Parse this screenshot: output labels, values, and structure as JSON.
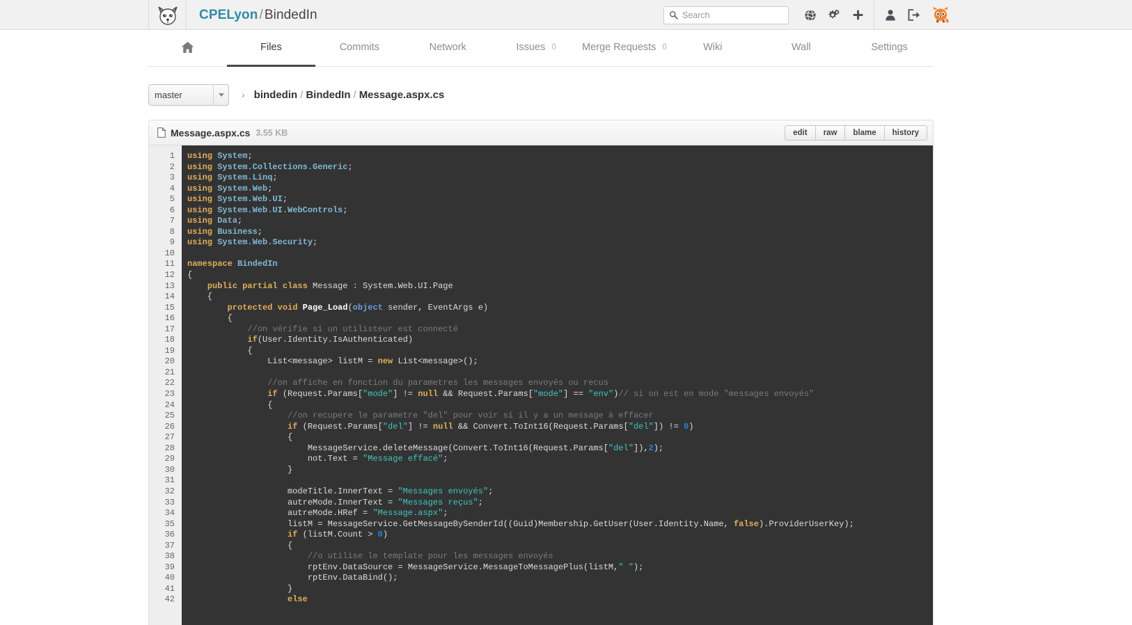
{
  "header": {
    "logo_icon": "gitlab-fox-logo",
    "namespace": "CPELyon",
    "separator": "/",
    "project": "BindedIn",
    "search_placeholder": "Search",
    "search_value": "",
    "icons": [
      {
        "name": "public-explore-icon",
        "glyph": "globe"
      },
      {
        "name": "admin-settings-icon",
        "glyph": "gears"
      },
      {
        "name": "new-project-icon",
        "glyph": "plus"
      },
      {
        "name": "profile-icon",
        "glyph": "user"
      },
      {
        "name": "sign-out-icon",
        "glyph": "logout"
      }
    ],
    "avatar_name": "user-avatar-fox"
  },
  "nav": {
    "items": [
      {
        "label": "",
        "name": "home",
        "icon": "home-icon",
        "active": false
      },
      {
        "label": "Files",
        "name": "files",
        "active": true
      },
      {
        "label": "Commits",
        "name": "commits",
        "active": false
      },
      {
        "label": "Network",
        "name": "network",
        "active": false
      },
      {
        "label": "Issues",
        "name": "issues",
        "count": "0",
        "active": false
      },
      {
        "label": "Merge Requests",
        "name": "merge-requests",
        "count": "0",
        "active": false
      },
      {
        "label": "Wiki",
        "name": "wiki",
        "active": false
      },
      {
        "label": "Wall",
        "name": "wall",
        "active": false
      },
      {
        "label": "Settings",
        "name": "settings",
        "active": false
      }
    ]
  },
  "branch": {
    "selected": "master",
    "chevron": "›"
  },
  "breadcrumb": {
    "parts": [
      "bindedin",
      "BindedIn",
      "Message.aspx.cs"
    ]
  },
  "file": {
    "icon": "file-icon",
    "name": "Message.aspx.cs",
    "size": "3.55 KB",
    "actions": [
      {
        "label": "edit",
        "name": "edit-button"
      },
      {
        "label": "raw",
        "name": "raw-button"
      },
      {
        "label": "blame",
        "name": "blame-button"
      },
      {
        "label": "history",
        "name": "history-button"
      }
    ]
  },
  "code": {
    "first_line": 1,
    "last_visible_line": 42,
    "language": "csharp",
    "lines": [
      [
        [
          "k",
          "using "
        ],
        [
          "ns",
          "System"
        ],
        [
          "pn",
          ";"
        ]
      ],
      [
        [
          "k",
          "using "
        ],
        [
          "ns",
          "System.Collections.Generic"
        ],
        [
          "pn",
          ";"
        ]
      ],
      [
        [
          "k",
          "using "
        ],
        [
          "ns",
          "System.Linq"
        ],
        [
          "pn",
          ";"
        ]
      ],
      [
        [
          "k",
          "using "
        ],
        [
          "ns",
          "System.Web"
        ],
        [
          "pn",
          ";"
        ]
      ],
      [
        [
          "k",
          "using "
        ],
        [
          "ns",
          "System.Web.UI"
        ],
        [
          "pn",
          ";"
        ]
      ],
      [
        [
          "k",
          "using "
        ],
        [
          "ns",
          "System.Web.UI.WebControls"
        ],
        [
          "pn",
          ";"
        ]
      ],
      [
        [
          "k",
          "using "
        ],
        [
          "ns",
          "Data"
        ],
        [
          "pn",
          ";"
        ]
      ],
      [
        [
          "k",
          "using "
        ],
        [
          "ns",
          "Business"
        ],
        [
          "pn",
          ";"
        ]
      ],
      [
        [
          "k",
          "using "
        ],
        [
          "ns",
          "System.Web.Security"
        ],
        [
          "pn",
          ";"
        ]
      ],
      [],
      [
        [
          "k",
          "namespace "
        ],
        [
          "ns",
          "BindedIn"
        ]
      ],
      [
        [
          "pn",
          "{"
        ]
      ],
      [
        [
          "pn",
          "    "
        ],
        [
          "k",
          "public partial class "
        ],
        [
          "pn",
          "Message : System.Web.UI.Page"
        ]
      ],
      [
        [
          "pn",
          "    {"
        ]
      ],
      [
        [
          "pn",
          "        "
        ],
        [
          "k",
          "protected void "
        ],
        [
          "fn",
          "Page_Load"
        ],
        [
          "pn",
          "("
        ],
        [
          "bl",
          "object"
        ],
        [
          "pn",
          " sender, EventArgs e)"
        ]
      ],
      [
        [
          "pn",
          "        {"
        ]
      ],
      [
        [
          "pn",
          "            "
        ],
        [
          "cm",
          "//on vérifie si un utilisteur est connecté"
        ]
      ],
      [
        [
          "pn",
          "            "
        ],
        [
          "k",
          "if"
        ],
        [
          "pn",
          "(User.Identity.IsAuthenticated)"
        ]
      ],
      [
        [
          "pn",
          "            {"
        ]
      ],
      [
        [
          "pn",
          "                List<message> listM = "
        ],
        [
          "k",
          "new"
        ],
        [
          "pn",
          " List<message>();"
        ]
      ],
      [],
      [
        [
          "pn",
          "                "
        ],
        [
          "cm",
          "//on affiche en fonction du parametres les messages envoyés ou recus"
        ]
      ],
      [
        [
          "pn",
          "                "
        ],
        [
          "k",
          "if"
        ],
        [
          "pn",
          " (Request.Params["
        ],
        [
          "st",
          "\"mode\""
        ],
        [
          "pn",
          "] != "
        ],
        [
          "k",
          "null"
        ],
        [
          "pn",
          " && Request.Params["
        ],
        [
          "st",
          "\"mode\""
        ],
        [
          "pn",
          "] == "
        ],
        [
          "st",
          "\"env\""
        ],
        [
          "pn",
          ")"
        ],
        [
          "cm",
          "// si on est en mode \"messages envoyés\""
        ]
      ],
      [
        [
          "pn",
          "                {"
        ]
      ],
      [
        [
          "pn",
          "                    "
        ],
        [
          "cm",
          "//on recupere le parametre \"del\" pour voir si il y a un message à effacer"
        ]
      ],
      [
        [
          "pn",
          "                    "
        ],
        [
          "k",
          "if"
        ],
        [
          "pn",
          " (Request.Params["
        ],
        [
          "st",
          "\"del\""
        ],
        [
          "pn",
          "] != "
        ],
        [
          "k",
          "null"
        ],
        [
          "pn",
          " && Convert.ToInt16(Request.Params["
        ],
        [
          "st",
          "\"del\""
        ],
        [
          "pn",
          "]) != "
        ],
        [
          "nu",
          "0"
        ],
        [
          "pn",
          ")"
        ]
      ],
      [
        [
          "pn",
          "                    {"
        ]
      ],
      [
        [
          "pn",
          "                        MessageService.deleteMessage(Convert.ToInt16(Request.Params["
        ],
        [
          "st",
          "\"del\""
        ],
        [
          "pn",
          "]),"
        ],
        [
          "nu",
          "2"
        ],
        [
          "pn",
          ");"
        ]
      ],
      [
        [
          "pn",
          "                        not.Text = "
        ],
        [
          "st",
          "\"Message effacé\""
        ],
        [
          "pn",
          ";"
        ]
      ],
      [
        [
          "pn",
          "                    }"
        ]
      ],
      [],
      [
        [
          "pn",
          "                    modeTitle.InnerText = "
        ],
        [
          "st",
          "\"Messages envoyés\""
        ],
        [
          "pn",
          ";"
        ]
      ],
      [
        [
          "pn",
          "                    autreMode.InnerText = "
        ],
        [
          "st",
          "\"Messages reçus\""
        ],
        [
          "pn",
          ";"
        ]
      ],
      [
        [
          "pn",
          "                    autreMode.HRef = "
        ],
        [
          "st",
          "\"Message.aspx\""
        ],
        [
          "pn",
          ";"
        ]
      ],
      [
        [
          "pn",
          "                    listM = MessageService.GetMessageBySenderId((Guid)Membership.GetUser(User.Identity.Name, "
        ],
        [
          "k",
          "false"
        ],
        [
          "pn",
          ").ProviderUserKey);"
        ]
      ],
      [
        [
          "pn",
          "                    "
        ],
        [
          "k",
          "if"
        ],
        [
          "pn",
          " (listM.Count > "
        ],
        [
          "nu",
          "0"
        ],
        [
          "pn",
          ")"
        ]
      ],
      [
        [
          "pn",
          "                    {"
        ]
      ],
      [
        [
          "pn",
          "                        "
        ],
        [
          "cm",
          "//o utilise le template pour les messages envoyés"
        ]
      ],
      [
        [
          "pn",
          "                        rptEnv.DataSource = MessageService.MessageToMessagePlus(listM,"
        ],
        [
          "st",
          "\" \""
        ],
        [
          "pn",
          ");"
        ]
      ],
      [
        [
          "pn",
          "                        rptEnv.DataBind();"
        ]
      ],
      [
        [
          "pn",
          "                    }"
        ]
      ],
      [
        [
          "pn",
          "                    "
        ],
        [
          "k",
          "else"
        ]
      ]
    ]
  }
}
